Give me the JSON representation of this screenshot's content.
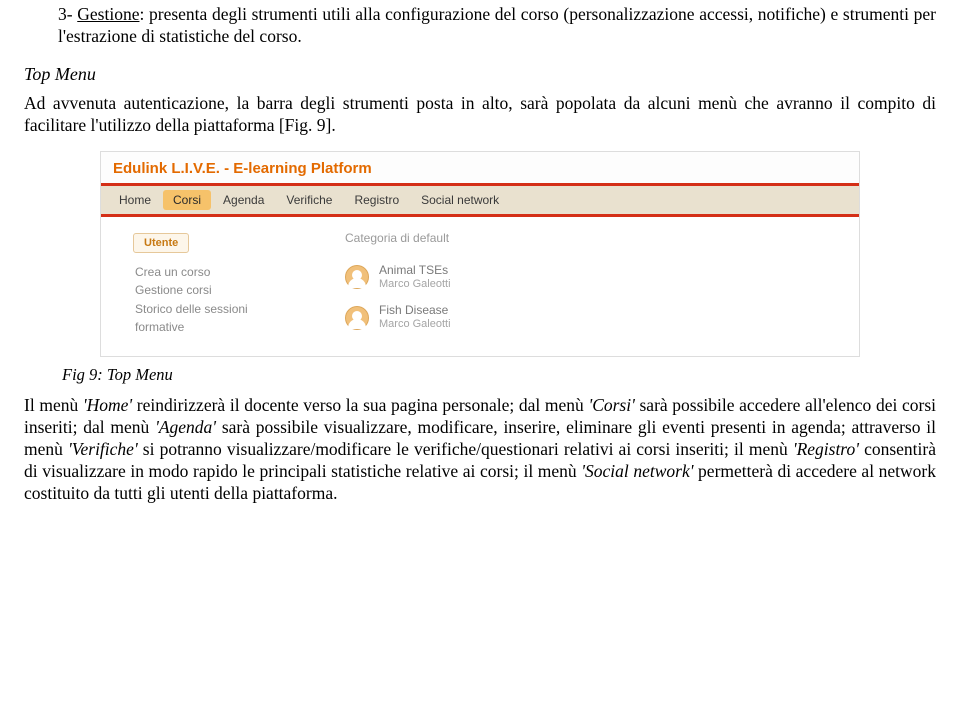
{
  "p1_num": "3- ",
  "p1_title": "Gestione",
  "p1_rest": ": presenta degli strumenti utili alla configurazione del corso (personalizzazione accessi, notifiche) e strumenti per l'estrazione di statistiche del corso.",
  "sect_head": "Top Menu",
  "p2": "Ad avvenuta autenticazione, la barra degli strumenti posta in alto, sarà popolata da alcuni menù che avranno il compito di facilitare l'utilizzo della piattaforma [Fig. 9].",
  "fig": {
    "app_title": "Edulink L.I.V.E. - E-learning Platform",
    "menu": [
      "Home",
      "Corsi",
      "Agenda",
      "Verifiche",
      "Registro",
      "Social network"
    ],
    "menu_active_index": 1,
    "sidebar_chip": "Utente",
    "sidebar_items": [
      "Crea un corso",
      "Gestione corsi",
      "Storico delle sessioni",
      "formative"
    ],
    "panel_head": "Categoria di default",
    "courses": [
      {
        "name": "Animal TSEs",
        "author": "Marco Galeotti"
      },
      {
        "name": "Fish Disease",
        "author": "Marco Galeotti"
      }
    ]
  },
  "caption": "Fig 9: Top Menu",
  "p3_a": "Il menù ",
  "p3_home": "'Home'",
  "p3_b": " reindirizzerà il docente verso la sua pagina personale; dal menù ",
  "p3_corsi": "'Corsi'",
  "p3_c": " sarà possibile accedere all'elenco dei corsi inseriti; dal menù ",
  "p3_agenda": "'Agenda'",
  "p3_d": " sarà possibile visualizzare, modificare, inserire, eliminare gli eventi presenti in agenda; attraverso il menù ",
  "p3_verifiche": "'Verifiche'",
  "p3_e": " si potranno visualizzare/modificare le verifiche/questionari relativi ai corsi inseriti; il menù ",
  "p3_registro": "'Registro'",
  "p3_f": " consentirà di visualizzare in modo rapido le principali statistiche relative ai corsi; il menù ",
  "p3_social": "'Social network'",
  "p3_g": " permetterà di accedere al network costituito da tutti gli utenti della piattaforma."
}
